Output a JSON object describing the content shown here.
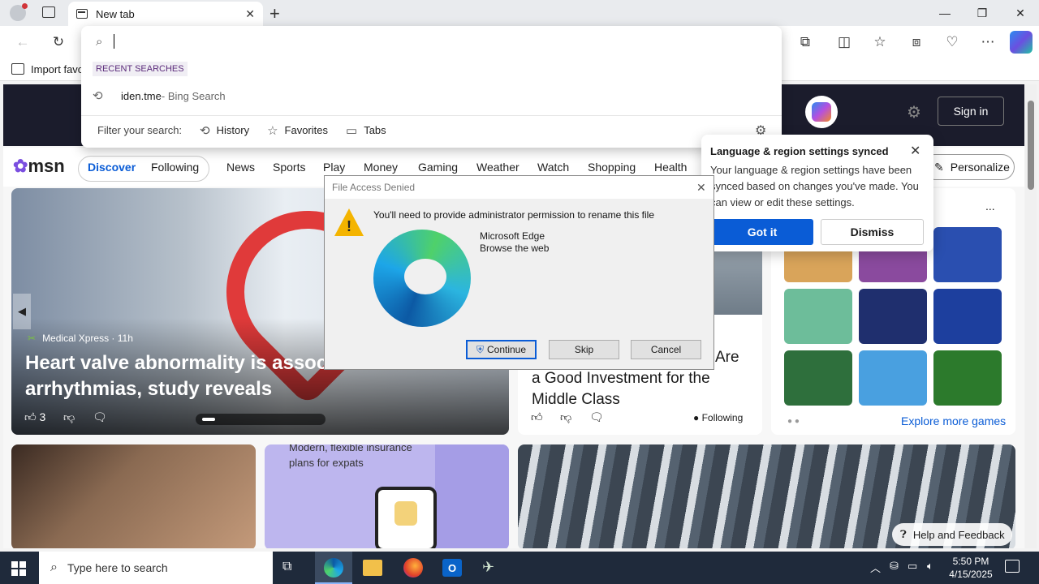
{
  "browser": {
    "tab_label": "New tab",
    "favbar_label": "Import favo"
  },
  "omnibox": {
    "recent_header": "RECENT SEARCHES",
    "recent_item_query": "iden.tme",
    "recent_item_suffix": " - Bing Search",
    "filter_label": "Filter your search:",
    "chips": [
      "History",
      "Favorites",
      "Tabs"
    ]
  },
  "msn": {
    "logo": "msn",
    "sign_in": "Sign in",
    "personalize": "Personalize",
    "tabs": [
      "Discover",
      "Following"
    ],
    "nav": [
      "News",
      "Sports",
      "Play",
      "Money",
      "Gaming",
      "Weather",
      "Watch",
      "Shopping",
      "Health"
    ],
    "hero_source": "Medical Xpress · 11h",
    "hero_title": "Heart valve abnormality is associ... arrhythmias, study reveals",
    "hero_title_l1": "Heart valve abnormality is associa",
    "hero_title_l2": "arrhythmias, study reveals",
    "hero_likes": "3",
    "story2_title_l0": "Are",
    "story2_title_l1": "a Good Investment for the",
    "story2_title_l2": "Middle Class",
    "following": "Following",
    "ins_text_l1": "Modern, flexible insurance",
    "ins_text_l2": "plans for expats",
    "explore_games": "Explore more games",
    "help_feedback": "Help and Feedback",
    "games_more": "..."
  },
  "popover": {
    "title": "Language & region settings synced",
    "body": "Your language & region settings have been synced based on changes you've made. You can view or edit these settings.",
    "got_it": "Got it",
    "dismiss": "Dismiss"
  },
  "dialog": {
    "title": "File Access Denied",
    "message": "You'll need to provide administrator permission to rename this file",
    "app_name": "Microsoft Edge",
    "app_desc": "Browse the web",
    "continue": "Continue",
    "skip": "Skip",
    "cancel": "Cancel"
  },
  "taskbar": {
    "search_placeholder": "Type here to search",
    "time": "5:50 PM",
    "date": "4/15/2025"
  },
  "colors": {
    "accent": "#0a5cd6",
    "taskbar": "#1f2a3b",
    "recent_header": "#5a2a7a"
  }
}
